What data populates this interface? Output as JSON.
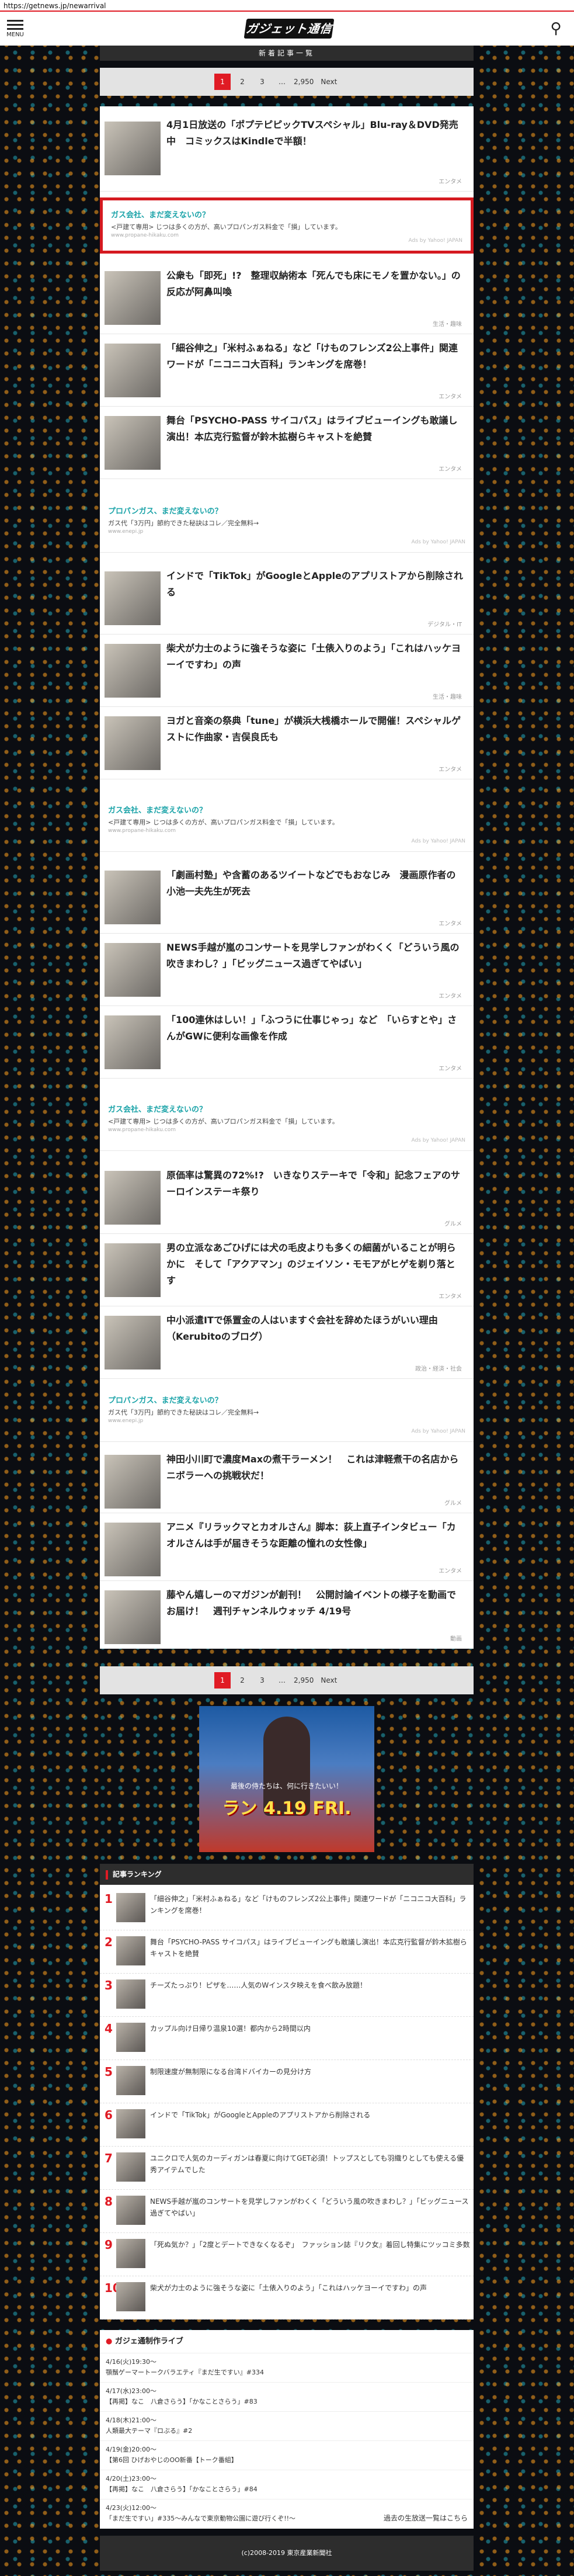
{
  "url": "https://getnews.jp/newarrival",
  "header": {
    "menu_label": "MENU",
    "logo_text": "ガジェット通信"
  },
  "section_title": "新着記事一覧",
  "pager": {
    "pages": [
      "1",
      "2",
      "3",
      "…",
      "2,950"
    ],
    "next": "Next"
  },
  "articles": [
    {
      "title": "4月1日放送の「ポプテピピックTVスペシャル」Blu-ray＆DVD発売中　コミックスはKindleで半額！",
      "meta": "エンタメ"
    },
    {
      "title": "公衆も「即死」!?　整理収納術本「死んでも床にモノを置かない。」の反応が阿鼻叫喚",
      "meta": "生活・趣味"
    },
    {
      "title": "「細谷伸之」「米村ふぁねる」など「けものフレンズ2公上事件」関連ワードが「ニコニコ大百科」ランキングを席巻！",
      "meta": "エンタメ"
    },
    {
      "title": "舞台「PSYCHO-PASS サイコパス」はライブビューイングも敢議し演出！本広克行監督が鈴木拡樹らキャストを絶賛",
      "meta": "エンタメ"
    },
    {
      "title": "インドで「TikTok」がGoogleとAppleのアプリストアから削除される",
      "meta": "デジタル・IT"
    },
    {
      "title": "柴犬が力士のように強そうな姿に「土俵入りのよう」「これはハッケヨーイですわ」の声",
      "meta": "生活・趣味"
    },
    {
      "title": "ヨガと音楽の祭典「tune」が横浜大桟橋ホールで開催！スペシャルゲストに作曲家・吉俣良氏も",
      "meta": "エンタメ"
    },
    {
      "title": "「劇画村塾」や含蓄のあるツイートなどでもおなじみ　漫画原作者の小池一夫先生が死去",
      "meta": "エンタメ"
    },
    {
      "title": "NEWS手越が嵐のコンサートを見学しファンがわくく「どういう風の吹きまわし？」「ビッグニュース過ぎてやばい」",
      "meta": "エンタメ"
    },
    {
      "title": "「100連休はしい！」「ふつうに仕事じゃっ」など　「いらすとや」さんがGWに便利な画像を作成",
      "meta": "エンタメ"
    },
    {
      "title": "原価率は驚異の72%!?　いきなりステーキで「令和」記念フェアのサーロインステーキ祭り",
      "meta": "グルメ"
    },
    {
      "title": "男の立派なあごひげには犬の毛皮よりも多くの細菌がいることが明らかに　そして「アクアマン」のジェイソン・モモアがヒゲを剃り落とす",
      "meta": "エンタメ"
    },
    {
      "title": "中小派遣ITで係置金の人はいますぐ会社を辞めたほうがいい理由（Kerubitoのブログ）",
      "meta": "政治・経済・社会"
    },
    {
      "title": "神田小川町で濃度Maxの煮干ラーメン！　これは津軽煮干の名店からニボラーへの挑戦状だ！",
      "meta": "グルメ"
    },
    {
      "title": "アニメ『リラックマとカオルさん』脚本：荻上直子インタビュー「カオルさんは手が届きそうな距離の憧れの女性像」",
      "meta": "エンタメ"
    },
    {
      "title": "藤やん嬉しーのマガジンが創刊！　公開討論イベントの様子を動画でお届け！　週刊チャンネルウォッチ 4/19号",
      "meta": "動画"
    }
  ],
  "ads": [
    {
      "title": "ガス会社、まだ変えないの？",
      "body": "<戸建て専用> じつは多くの方が、高いプロパンガス料金で「損」しています。",
      "url": "www.propane-hikaku.com",
      "by": "Ads by Yahoo! JAPAN"
    },
    {
      "title": "プロパンガス、まだ変えないの？",
      "body": "ガス代「3万円」節約できた秘訣はコレ／完全無料→",
      "url": "www.enepi.jp",
      "by": "Ads by Yahoo! JAPAN"
    }
  ],
  "banner": {
    "caption": "最後の侍たちは、何に行きたいい！",
    "text": "ラン 4.19 FRI."
  },
  "ranking": {
    "title": "記事ランキング",
    "items": [
      "「細谷伸之」「米村ふぁねる」など「けものフレンズ2公上事件」関連ワードが「ニコニコ大百科」ランキングを席巻！",
      "舞台「PSYCHO-PASS サイコパス」はライブビューイングも敢議し演出！本広克行監督が鈴木拡樹らキャストを絶賛",
      "チーズたっぷり！ピザを……人気のWインスタ映えを食べ飲み放題！",
      "カップル向け日帰り温泉10選！都内から2時間以内",
      "制限速度が無制限になる台湾ドバイカーの見分け方",
      "インドで「TikTok」がGoogleとAppleのアプリストアから削除される",
      "ユニクロで人気のカーディガンは春夏に向けてGET必須！トップスとしても羽織りとしても使える優秀アイテムでした",
      "NEWS手越が嵐のコンサートを見学しファンがわくく「どういう風の吹きまわし？」「ビッグニュース過ぎてやばい」",
      "「死ぬ気か？」「2度とデートできなくなるぞ」　ファッション誌『リク女』着回し特集にツッコミ多数",
      "柴犬が力士のように強そうな姿に「土俵入りのよう」「これはハッケヨーイですわ」の声"
    ]
  },
  "schedule": {
    "title": "ガジェ通制作ライブ",
    "items": [
      {
        "time": "4/16(火)19:30〜",
        "title": "顎鬚ゲーマートークバラエティ『まだ生ですい』#334"
      },
      {
        "time": "4/17(水)23:00〜",
        "title": "【再掲】なこ　八倉さらう】「かなことさらう」#83"
      },
      {
        "time": "4/18(木)21:00〜",
        "title": "人類最大テーマ『ロぶる』#2"
      },
      {
        "time": "4/19(金)20:00〜",
        "title": "【第6回 ひげおやじのOO新番【トーク番組】"
      },
      {
        "time": "4/20(土)23:00〜",
        "title": "【再掲】なこ　八倉さらう】「かなことさらう」#84"
      },
      {
        "time": "4/23(火)12:00〜",
        "title": "「まだ生ですい」#335〜みんなで東京動物公園に遊び行くぞ!!〜"
      }
    ],
    "more": "過去の生放送一覧はこちら"
  },
  "footer": "(c)2008-2019 東京産業新聞社"
}
